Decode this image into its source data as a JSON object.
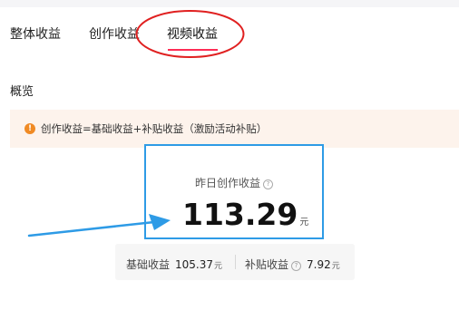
{
  "tabs": [
    {
      "label": "整体收益"
    },
    {
      "label": "创作收益"
    },
    {
      "label": "视频收益"
    }
  ],
  "active_tab": "视频收益",
  "section": {
    "title": "概览"
  },
  "notice": {
    "text": "创作收益=基础收益+补贴收益（激励活动补贴）",
    "icon": "exclamation-icon",
    "color": "#f08a24"
  },
  "summary_card": {
    "label": "昨日创作收益",
    "value": "113.29",
    "unit": "元"
  },
  "breakdown": {
    "base": {
      "label": "基础收益",
      "value": "105.37",
      "unit": "元"
    },
    "subsidy": {
      "label": "补贴收益",
      "value": "7.92",
      "unit": "元"
    }
  },
  "colors": {
    "accent": "#fe2c55",
    "annotation_red": "#e02020",
    "annotation_blue": "#2e9be6"
  }
}
